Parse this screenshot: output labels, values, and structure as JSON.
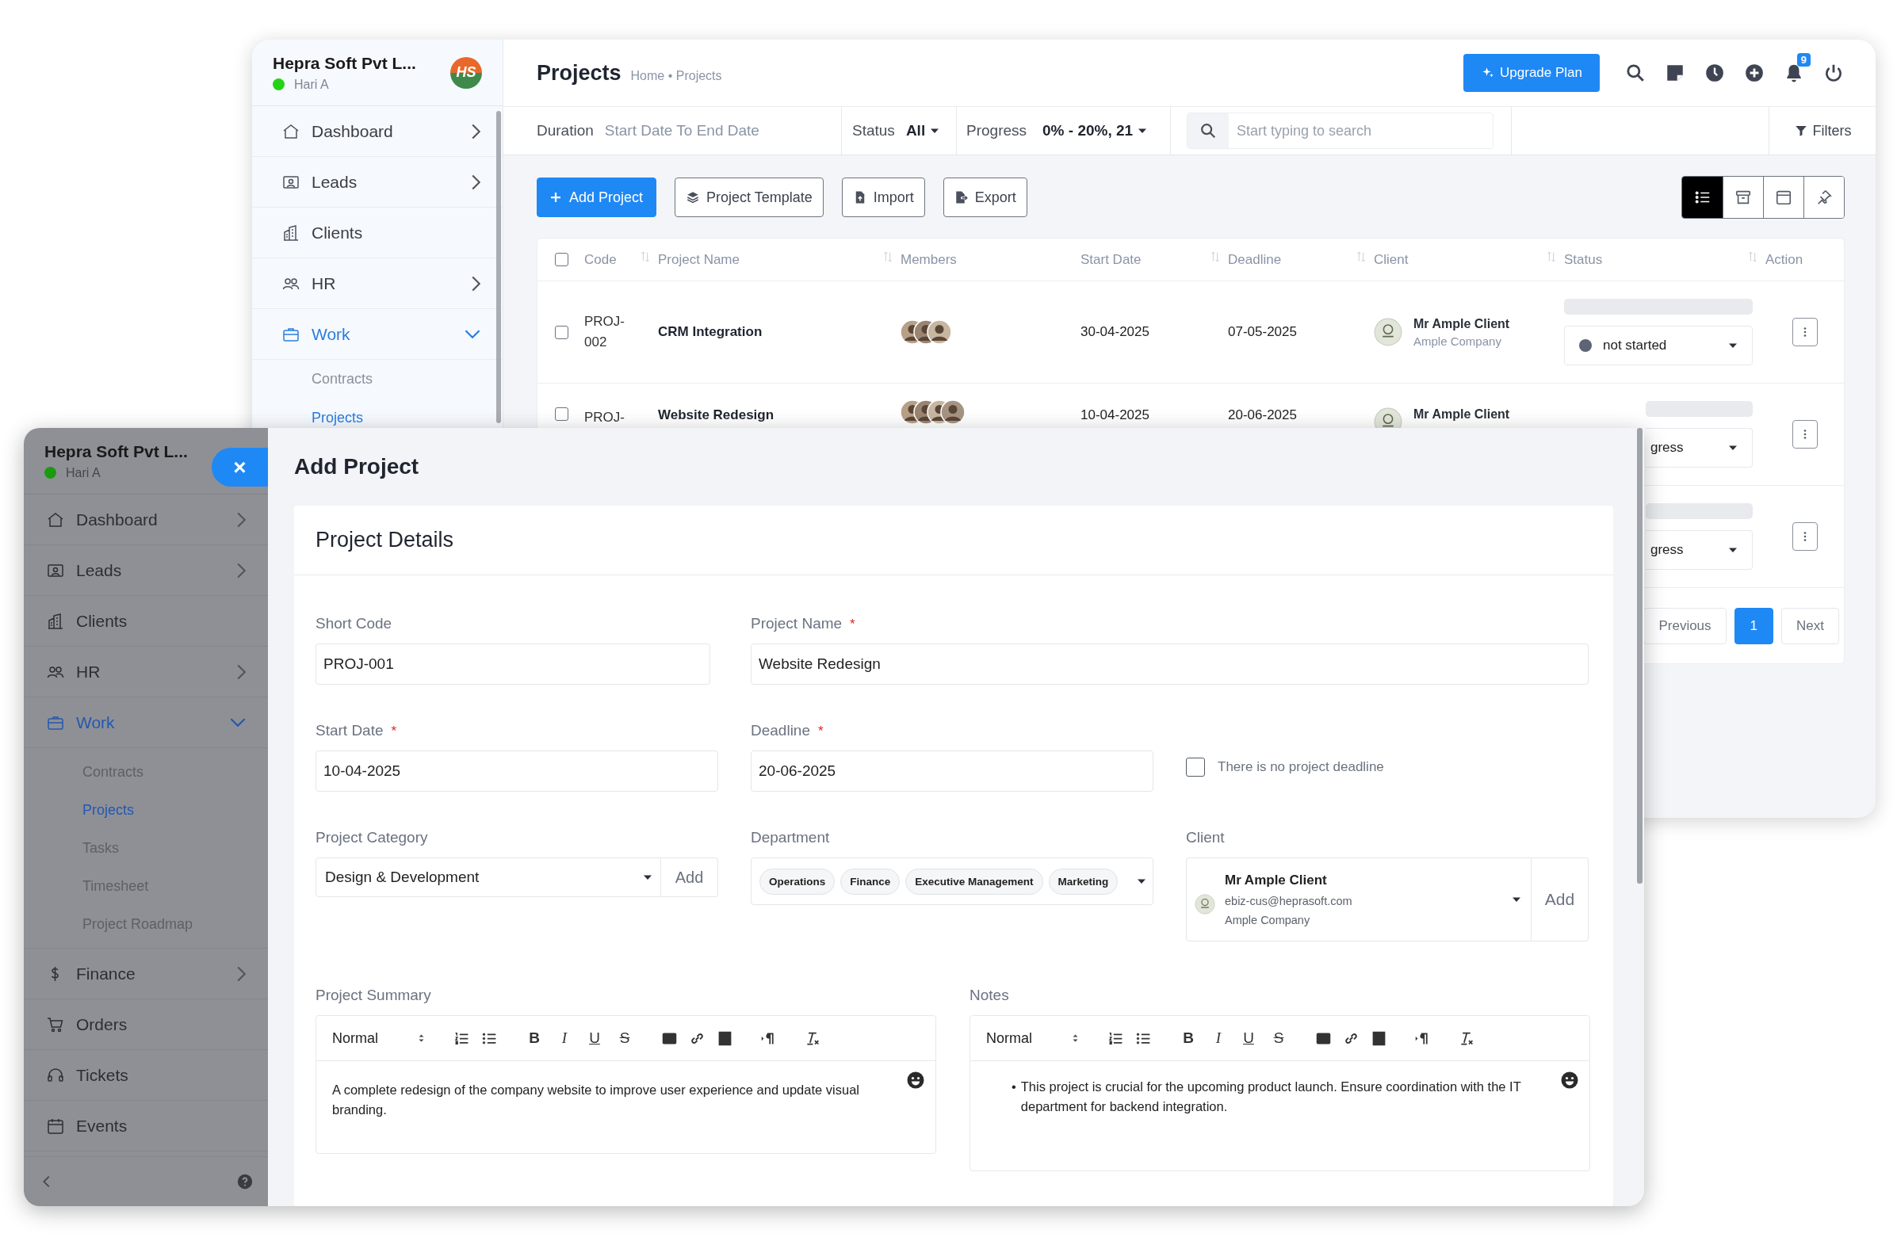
{
  "back_window": {
    "sidebar": {
      "company": "Hepra Soft Pvt L...",
      "user": "Hari A",
      "online": true,
      "logo_text": "HS",
      "items": [
        {
          "label": "Dashboard",
          "expandable": true,
          "expanded": false,
          "selected": false
        },
        {
          "label": "Leads",
          "expandable": true,
          "expanded": false,
          "selected": false
        },
        {
          "label": "Clients",
          "expandable": false,
          "selected": false
        },
        {
          "label": "HR",
          "expandable": true,
          "expanded": false,
          "selected": false
        },
        {
          "label": "Work",
          "expandable": true,
          "expanded": true,
          "selected": true,
          "children": [
            {
              "label": "Contracts",
              "selected": false
            },
            {
              "label": "Projects",
              "selected": true
            }
          ]
        }
      ]
    },
    "header": {
      "title": "Projects",
      "breadcrumb": "Home • Projects",
      "upgrade_button": "Upgrade Plan",
      "notification_count": "9"
    },
    "filter_bar": {
      "duration_label": "Duration",
      "duration_value": "Start Date To End Date",
      "status_label": "Status",
      "status_value": "All",
      "progress_label": "Progress",
      "progress_value": "0% - 20%, 21",
      "search_placeholder": "Start typing to search",
      "filters_button": "Filters"
    },
    "actions": [
      {
        "label": "Add Project",
        "primary": true
      },
      {
        "label": "Project Template",
        "primary": false
      },
      {
        "label": "Import",
        "primary": false
      },
      {
        "label": "Export",
        "primary": false
      }
    ],
    "view_toggles": [
      {
        "selected": true
      },
      {
        "selected": false
      },
      {
        "selected": false
      },
      {
        "selected": false
      }
    ],
    "table": {
      "select_all_checked": false,
      "columns": [
        {
          "label": "Code",
          "sortable": true
        },
        {
          "label": "Project Name",
          "sortable": true
        },
        {
          "label": "Members",
          "sortable": false
        },
        {
          "label": "Start Date",
          "sortable": true
        },
        {
          "label": "Deadline",
          "sortable": true
        },
        {
          "label": "Client",
          "sortable": true
        },
        {
          "label": "Status",
          "sortable": true
        },
        {
          "label": "Action",
          "sortable": false
        }
      ],
      "rows": [
        {
          "checked": false,
          "code": "PROJ-002",
          "name": "CRM Integration",
          "members": [
            {
              "kind": "photo"
            },
            {
              "kind": "photo"
            },
            {
              "kind": "photo"
            }
          ],
          "start_date": "30-04-2025",
          "deadline": "07-05-2025",
          "client_name": "Mr Ample Client",
          "client_company": "Ample Company",
          "level": 0,
          "status": "not started",
          "color": "#5c6475"
        },
        {
          "checked": false,
          "code": "PROJ-",
          "name": "Website Redesign",
          "members": [
            {
              "kind": "photo"
            },
            {
              "kind": "photo"
            },
            {
              "kind": "photo"
            },
            {
              "kind": "photo"
            }
          ],
          "start_date": "10-04-2025",
          "deadline": "20-06-2025",
          "client_name": "Mr Ample Client",
          "level": 0,
          "status": "gress"
        },
        {
          "level": 0,
          "status": "gress"
        }
      ]
    },
    "pagination": [
      {
        "label": "Previous",
        "selected": false
      },
      {
        "label": "1",
        "selected": true
      },
      {
        "label": "Next",
        "selected": false
      }
    ]
  },
  "front_window": {
    "close_button": "×",
    "sidebar": {
      "company": "Hepra Soft Pvt L...",
      "user": "Hari A",
      "online": true,
      "items": [
        {
          "label": "Dashboard",
          "expandable": true,
          "expanded": false,
          "selected": false
        },
        {
          "label": "Leads",
          "expandable": true,
          "expanded": false,
          "selected": false
        },
        {
          "label": "Clients",
          "expandable": false,
          "selected": false
        },
        {
          "label": "HR",
          "expandable": true,
          "expanded": false,
          "selected": false
        },
        {
          "label": "Work",
          "expandable": true,
          "expanded": true,
          "selected": true,
          "children": [
            {
              "label": "Contracts",
              "selected": false
            },
            {
              "label": "Projects",
              "selected": true
            },
            {
              "label": "Tasks",
              "selected": false
            },
            {
              "label": "Timesheet",
              "selected": false
            },
            {
              "label": "Project Roadmap",
              "selected": false
            }
          ]
        },
        {
          "label": "Finance",
          "expandable": true,
          "expanded": false,
          "selected": false
        },
        {
          "label": "Orders",
          "expandable": false,
          "selected": false
        },
        {
          "label": "Tickets",
          "expandable": false,
          "selected": false
        },
        {
          "label": "Events",
          "expandable": false,
          "selected": false
        }
      ]
    },
    "form": {
      "title": "Add Project",
      "card_title": "Project Details",
      "short_code": {
        "label": "Short Code",
        "value": "PROJ-001"
      },
      "project_name": {
        "label": "Project Name",
        "required_mark": "*",
        "value": "Website Redesign"
      },
      "start_date": {
        "label": "Start Date",
        "required_mark": "*",
        "value": "10-04-2025"
      },
      "deadline": {
        "label": "Deadline",
        "required_mark": "*",
        "value": "20-06-2025"
      },
      "no_deadline": {
        "label": "There is no project deadline",
        "checked": false
      },
      "category": {
        "label": "Project Category",
        "value": "Design & Development",
        "add_button": "Add"
      },
      "department": {
        "label": "Department",
        "tags": [
          "Operations",
          "Finance",
          "Executive Management",
          "Marketing"
        ]
      },
      "client": {
        "label": "Client",
        "name": "Mr Ample Client",
        "email": "ebiz-cus@heprasoft.com",
        "company": "Ample Company",
        "add_button": "Add"
      },
      "editors": [
        {
          "label": "Project Summary",
          "format": "Normal",
          "buttons": [
            "B",
            "I",
            "U",
            "S"
          ],
          "kind": "paragraph",
          "text": "A complete redesign of the company website to improve user experience and update visual branding."
        },
        {
          "label": "Notes",
          "format": "Normal",
          "buttons": [
            "B",
            "I",
            "U",
            "S"
          ],
          "kind": "bullets",
          "marker": "•",
          "items": [
            "This project is crucial for the upcoming product launch. Ensure coordination with the IT department for backend integration."
          ]
        }
      ]
    }
  }
}
